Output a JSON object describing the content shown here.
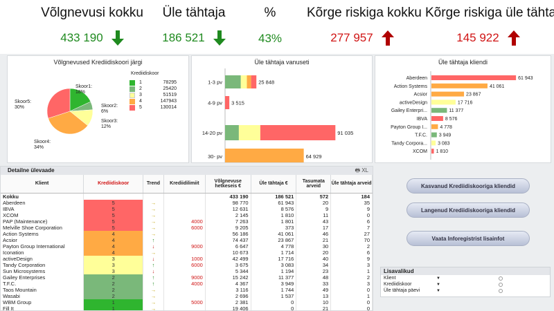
{
  "kpis": [
    {
      "title": "Võlgnevusi kokku",
      "value": "433 190",
      "trend": "down"
    },
    {
      "title": "Üle tähtaja",
      "value": "186 521",
      "trend": "down"
    },
    {
      "title": "%",
      "value": "43%",
      "trend": "none"
    },
    {
      "title": "Kõrge riskiga kokku",
      "value": "277 957",
      "trend": "up"
    },
    {
      "title": "Kõrge riskiga üle tähtaja",
      "value": "145 922",
      "trend": "up"
    }
  ],
  "colors": {
    "green": "#1f8a1f",
    "red": "#d01414",
    "s1": "#2fb52f",
    "s2": "#7ab87a",
    "s3": "#ffff99",
    "s4": "#ffaa44",
    "s5": "#ff6666"
  },
  "pie": {
    "title": "Võlgnevused Krediidiskoori järgi",
    "legend_title": "Krediidiskoor",
    "chart_data": {
      "type": "pie",
      "categories": [
        "1",
        "2",
        "3",
        "4",
        "5"
      ],
      "values": [
        78295,
        25420,
        51519,
        147943,
        130014
      ],
      "slice_labels": [
        "Skoor1:\n18%",
        "Skoor2:\n6%",
        "Skoor3:\n12%",
        "Skoor4:\n34%",
        "Skoor5:\n30%"
      ]
    },
    "legend_vals": [
      "78295",
      "25420",
      "51519",
      "147943",
      "130014"
    ]
  },
  "aging": {
    "title": "Üle tähtaja vanuseti",
    "chart_data": {
      "type": "bar",
      "categories": [
        "1-3 pv",
        "4-9 pv",
        "14-20 pv",
        "30- pv"
      ],
      "totals": [
        25848,
        3515,
        91035,
        64929
      ],
      "total_labels": [
        "25 848",
        "3 515",
        "91 035",
        "64 929"
      ],
      "segments": [
        [
          {
            "score": 2,
            "value": 13000
          },
          {
            "score": 3,
            "value": 5000
          },
          {
            "score": 4,
            "value": 3500
          },
          {
            "score": 5,
            "value": 4348
          }
        ],
        [
          {
            "score": 5,
            "value": 3515
          }
        ],
        [
          {
            "score": 2,
            "value": 11377
          },
          {
            "score": 3,
            "value": 17716
          },
          {
            "score": 5,
            "value": 61942
          }
        ],
        [
          {
            "score": 4,
            "value": 64929
          }
        ]
      ],
      "xlim": [
        0,
        100000
      ]
    }
  },
  "clients": {
    "title": "Üle tähtaja kliendi",
    "chart_data": {
      "type": "bar",
      "categories": [
        "Aberdeen",
        "Action Systems",
        "Acsior",
        "activeDesign",
        "Gailey Enterpri...",
        "IBVA",
        "Payton Group I...",
        "T.F.C.",
        "Tandy Corpora...",
        "XCOM"
      ],
      "values": [
        61943,
        41061,
        23867,
        17716,
        11377,
        8576,
        4778,
        3949,
        3083,
        1810
      ],
      "value_labels": [
        "61 943",
        "41 061",
        "23 867",
        "17 716",
        "11 377",
        "8 576",
        "4 778",
        "3 949",
        "3 083",
        "1 810"
      ],
      "scores": [
        5,
        4,
        4,
        3,
        2,
        5,
        4,
        2,
        3,
        5
      ],
      "xlim": [
        0,
        70000
      ]
    }
  },
  "grid": {
    "title": "Detailne ülevaade",
    "tools": "🖶 XL",
    "headers": [
      "Klient",
      "Krediidiskoor",
      "Trend",
      "Krediidilimiit",
      "Võlgnevuse hetkeseis €",
      "Üle tähtaja €",
      "Tasumata arveid",
      "Üle tähtaja arveid"
    ],
    "total": [
      "Kokku",
      "",
      "",
      "",
      "433 190",
      "186 521",
      "572",
      "184"
    ],
    "rows": [
      [
        "Aberdeen",
        "5",
        "→",
        "",
        "98 770",
        "61 943",
        "20",
        "35"
      ],
      [
        "IBVA",
        "5",
        "→",
        "",
        "12 631",
        "8 576",
        "9",
        "9"
      ],
      [
        "XCOM",
        "5",
        "→",
        "",
        "2 145",
        "1 810",
        "11",
        "0"
      ],
      [
        "PAP (Maintenance)",
        "5",
        "→",
        "4000",
        "7 263",
        "1 801",
        "43",
        "6"
      ],
      [
        "Melville Shoe Corporation",
        "5",
        "→",
        "6000",
        "9 205",
        "373",
        "17",
        "7"
      ],
      [
        "Action Systems",
        "4",
        "→",
        "",
        "56 186",
        "41 061",
        "46",
        "27"
      ],
      [
        "Acsior",
        "4",
        "↑",
        "",
        "74 437",
        "23 867",
        "21",
        "70"
      ],
      [
        "Payton Group International",
        "4",
        "↓",
        "9000",
        "6 647",
        "4 778",
        "30",
        "2"
      ],
      [
        "Iconation",
        "4",
        "→",
        "",
        "10 673",
        "1 714",
        "20",
        "6"
      ],
      [
        "activeDesign",
        "3",
        "↓",
        "1000",
        "42 499",
        "17 716",
        "40",
        "9"
      ],
      [
        "Tandy Corporation",
        "3",
        "↑",
        "6000",
        "3 675",
        "3 083",
        "34",
        "3"
      ],
      [
        "Sun Microsystems",
        "3",
        "↓",
        "",
        "5 344",
        "1 194",
        "23",
        "1"
      ],
      [
        "Gailey Enterprises",
        "2",
        "↑",
        "9000",
        "15 242",
        "11 377",
        "48",
        "2"
      ],
      [
        "T.F.C.",
        "2",
        "↑",
        "4000",
        "4 367",
        "3 949",
        "33",
        "3"
      ],
      [
        "Taos Mountain",
        "2",
        "→",
        "",
        "3 116",
        "1 744",
        "49",
        "0"
      ],
      [
        "Wasabi",
        "2",
        "→",
        "",
        "2 696",
        "1 537",
        "13",
        "1"
      ],
      [
        "WBM Group",
        "1",
        "→",
        "5000",
        "2 381",
        "0",
        "10",
        "0"
      ],
      [
        "Fill It",
        "1",
        "→",
        "",
        "19 406",
        "0",
        "21",
        "0"
      ]
    ]
  },
  "buttons": [
    "Kasvanud Krediidiskooriga kliendid",
    "Langenud Krediidiskooriga kliendid",
    "Vaata Inforegistrist lisainfot"
  ],
  "options": {
    "title": "Lisavalikud",
    "items": [
      "Klient",
      "Krediidiskoor",
      "Üle tähtaja päevi"
    ]
  }
}
